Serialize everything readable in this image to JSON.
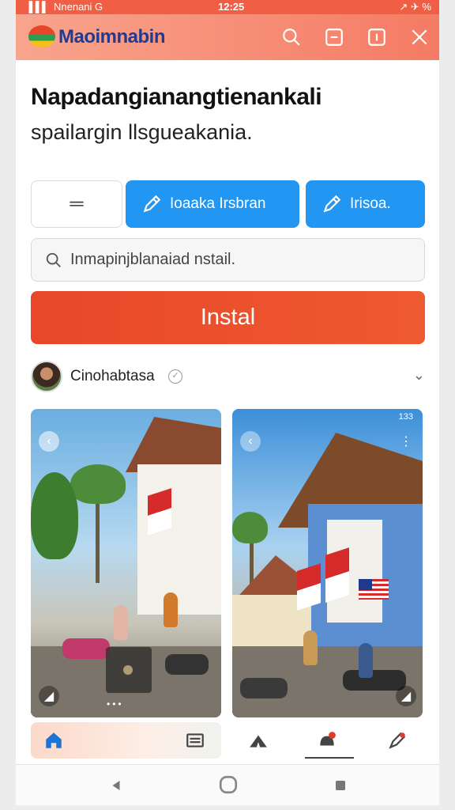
{
  "status_bar": {
    "signal": "▐▐▐",
    "carrier": "Nnenani G",
    "time": "12:25",
    "right_icons": "↗ ✈ %"
  },
  "header": {
    "app_name": "Maoimnabin",
    "icons": [
      "search-icon",
      "minus-square-icon",
      "info-square-icon",
      "close-icon"
    ]
  },
  "main": {
    "title": "Napadangianangtienankali",
    "subtitle": "spailargin llsgueakania.",
    "menu_button_label": "═",
    "button_a_label": "Ioaaka Irsbran",
    "button_b_label": "Irisoa.",
    "search": {
      "placeholder": "Inmapinjblanaiad nstail.",
      "value": ""
    },
    "install_label": "Instal"
  },
  "author": {
    "name": "Cinohabtasa",
    "verified_icon": "verified-icon",
    "chevron_icon": "chevron-down-icon"
  },
  "screenshots": [
    {
      "mini_status_left": "",
      "mini_status_right": "",
      "dots": "•••"
    },
    {
      "mini_status_left": "",
      "mini_status_right": "133",
      "dots": ""
    }
  ],
  "bottom_nav_left": [
    "home-icon",
    "list-icon"
  ],
  "bottom_nav_right": [
    "tent-icon",
    "notification-icon",
    "pen-icon"
  ],
  "system_nav": [
    "back-icon",
    "home-circle-icon",
    "recents-icon"
  ],
  "colors": {
    "accent_orange": "#ee5a30",
    "header_gradient_end": "#f57b64",
    "button_blue": "#2196f3",
    "logo_text": "#233a8f"
  }
}
